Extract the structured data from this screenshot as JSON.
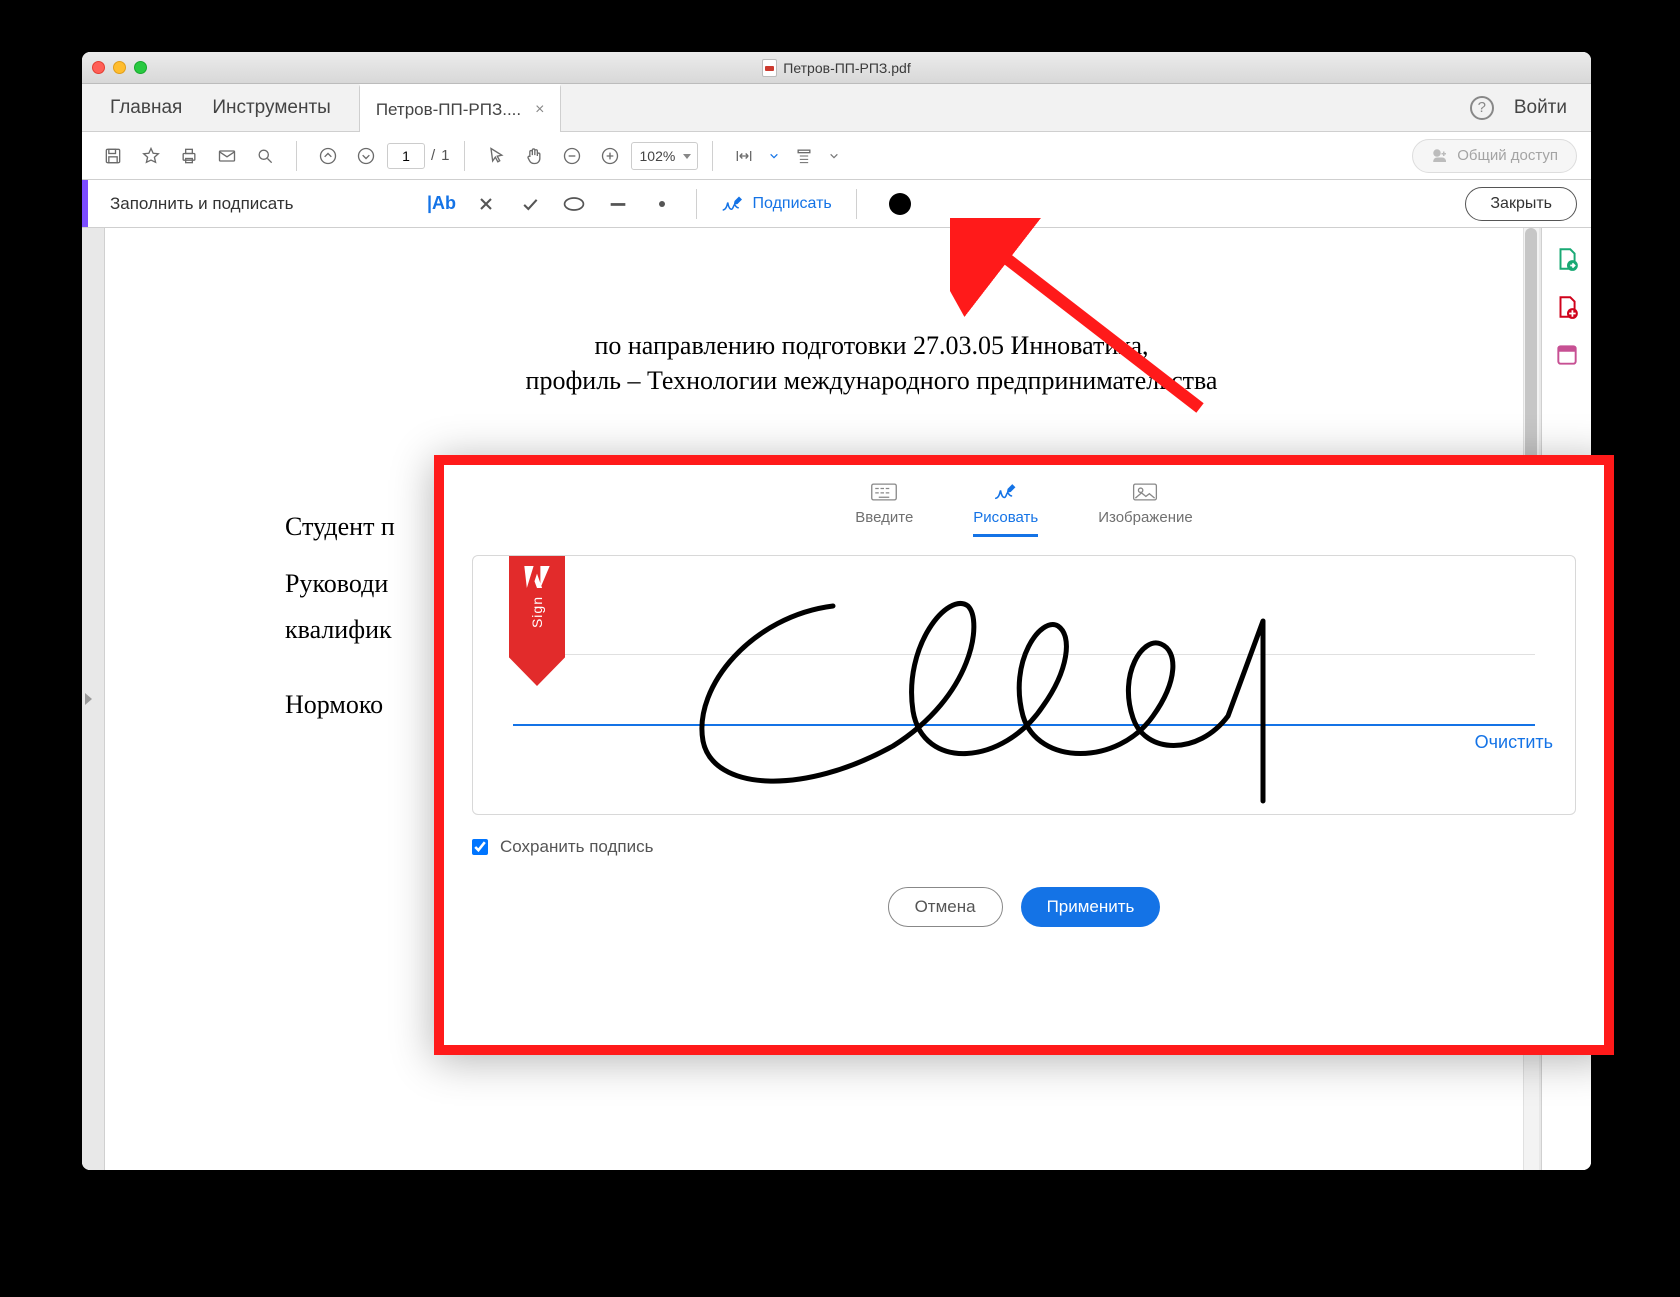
{
  "titlebar": {
    "filename": "Петров-ПП-РПЗ.pdf"
  },
  "tabs": {
    "home": "Главная",
    "tools": "Инструменты",
    "doc_tab_label": "Петров-ПП-РПЗ....",
    "login": "Войти"
  },
  "toolbar": {
    "page_current": "1",
    "page_total": "1",
    "zoom": "102%",
    "share_label": "Общий доступ"
  },
  "fill_sign": {
    "title": "Заполнить и подписать",
    "text_tool": "|Ab",
    "sign_label": "Подписать",
    "close_label": "Закрыть"
  },
  "document": {
    "line1": "по направлению подготовки 27.03.05 Инноватика,",
    "line2": "профиль – Технологии международного предпринимательства",
    "student": "Студент п",
    "supervisor1": "Руководи",
    "supervisor2": "квалифик",
    "norm": "Нормоко"
  },
  "modal": {
    "tab_type": "Введите",
    "tab_draw": "Рисовать",
    "tab_image": "Изображение",
    "ribbon_sign": "Sign",
    "clear": "Очистить",
    "save_signature": "Сохранить подпись",
    "cancel": "Отмена",
    "apply": "Применить"
  }
}
